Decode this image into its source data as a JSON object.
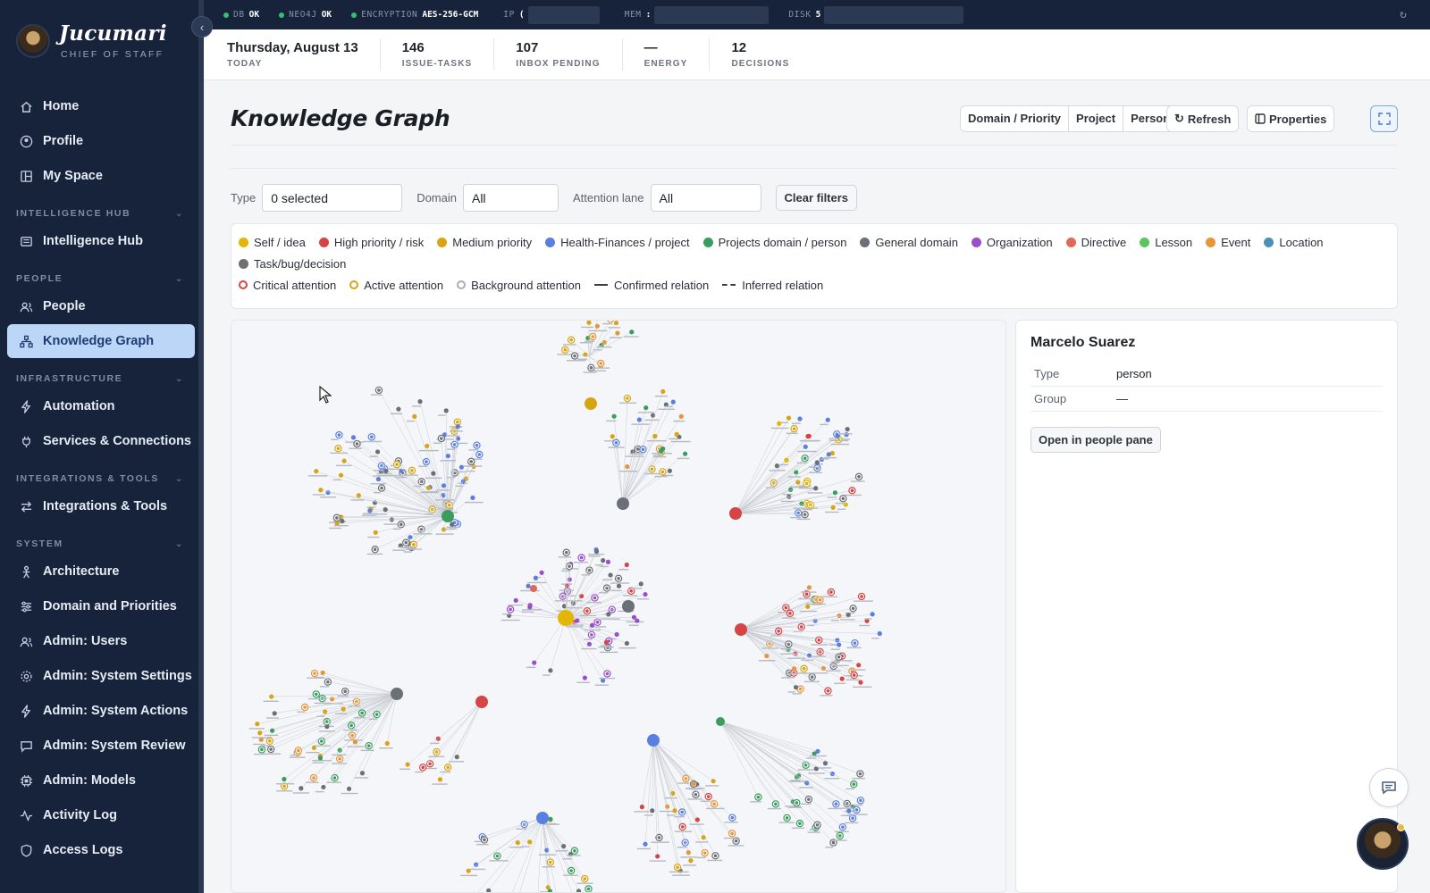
{
  "brand": {
    "name": "Jucumari",
    "subtitle": "CHIEF OF STAFF"
  },
  "sidebar": {
    "top_items": [
      {
        "label": "Home",
        "icon": "home-icon"
      },
      {
        "label": "Profile",
        "icon": "user-circle-icon"
      },
      {
        "label": "My Space",
        "icon": "layout-icon"
      }
    ],
    "sections": [
      {
        "title": "INTELLIGENCE HUB",
        "items": [
          {
            "label": "Intelligence Hub",
            "icon": "newspaper-icon"
          }
        ]
      },
      {
        "title": "PEOPLE",
        "items": [
          {
            "label": "People",
            "icon": "users-icon"
          },
          {
            "label": "Knowledge Graph",
            "icon": "network-icon",
            "active": true
          }
        ]
      },
      {
        "title": "INFRASTRUCTURE",
        "items": [
          {
            "label": "Automation",
            "icon": "bolt-icon"
          },
          {
            "label": "Services & Connections",
            "icon": "plug-icon"
          }
        ]
      },
      {
        "title": "INTEGRATIONS & TOOLS",
        "items": [
          {
            "label": "Integrations & Tools",
            "icon": "arrows-icon"
          }
        ]
      },
      {
        "title": "SYSTEM",
        "items": [
          {
            "label": "Architecture",
            "icon": "person-stand-icon"
          },
          {
            "label": "Domain and Priorities",
            "icon": "sliders-icon"
          },
          {
            "label": "Admin: Users",
            "icon": "users-icon"
          },
          {
            "label": "Admin: System Settings",
            "icon": "gear-icon"
          },
          {
            "label": "Admin: System Actions",
            "icon": "bolt-icon"
          },
          {
            "label": "Admin: System Review",
            "icon": "message-icon"
          },
          {
            "label": "Admin: Models",
            "icon": "cpu-icon"
          },
          {
            "label": "Activity Log",
            "icon": "activity-icon"
          },
          {
            "label": "Access Logs",
            "icon": "shield-icon"
          }
        ]
      }
    ]
  },
  "statusbar": {
    "items": [
      {
        "key": "DB",
        "value": "OK"
      },
      {
        "key": "NEO4J",
        "value": "OK"
      },
      {
        "key": "ENCRYPTION",
        "value": "AES-256-GCM"
      }
    ],
    "redacted": [
      {
        "key": "IP",
        "value": "("
      },
      {
        "key": "MEM",
        "value": ":"
      },
      {
        "key": "DISK",
        "value": "5"
      }
    ]
  },
  "metrics": [
    {
      "value": "Thursday, August 13",
      "label": "TODAY"
    },
    {
      "value": "146",
      "label": "ISSUE-TASKS"
    },
    {
      "value": "107",
      "label": "INBOX PENDING"
    },
    {
      "value": "—",
      "label": "ENERGY"
    },
    {
      "value": "12",
      "label": "DECISIONS"
    }
  ],
  "page": {
    "title": "Knowledge Graph"
  },
  "view_modes": [
    "Domain / Priority",
    "Project",
    "Person"
  ],
  "toolbar": {
    "refresh_label": "Refresh",
    "properties_label": "Properties"
  },
  "filters": {
    "type": {
      "label": "Type",
      "value": "0 selected"
    },
    "domain": {
      "label": "Domain",
      "value": "All"
    },
    "attention": {
      "label": "Attention lane",
      "value": "All"
    },
    "clear_label": "Clear filters"
  },
  "legend": {
    "nodes": [
      {
        "label": "Self / idea",
        "color": "#e3b505"
      },
      {
        "label": "High priority / risk",
        "color": "#d64545"
      },
      {
        "label": "Medium priority",
        "color": "#d9a413"
      },
      {
        "label": "Health-Finances / project",
        "color": "#5a7fe0"
      },
      {
        "label": "Projects domain / person",
        "color": "#3a9d5d"
      },
      {
        "label": "General domain",
        "color": "#6b6f78"
      },
      {
        "label": "Organization",
        "color": "#9a4fc9"
      },
      {
        "label": "Directive",
        "color": "#e06a5a"
      },
      {
        "label": "Lesson",
        "color": "#5cc55c"
      },
      {
        "label": "Event",
        "color": "#e6953a"
      },
      {
        "label": "Location",
        "color": "#4a90b8"
      },
      {
        "label": "Task/bug/decision",
        "color": "#707070"
      }
    ],
    "attention": [
      {
        "label": "Critical attention",
        "color": "#d64545"
      },
      {
        "label": "Active attention",
        "color": "#d9a413"
      },
      {
        "label": "Background attention",
        "color": "#a8aeb6"
      }
    ],
    "relations": {
      "confirmed": "Confirmed relation",
      "inferred": "Inferred relation"
    }
  },
  "detail": {
    "name": "Marcelo Suarez",
    "props": [
      {
        "key": "Type",
        "value": "person"
      },
      {
        "key": "Group",
        "value": "—"
      }
    ],
    "open_label": "Open in people pane"
  }
}
